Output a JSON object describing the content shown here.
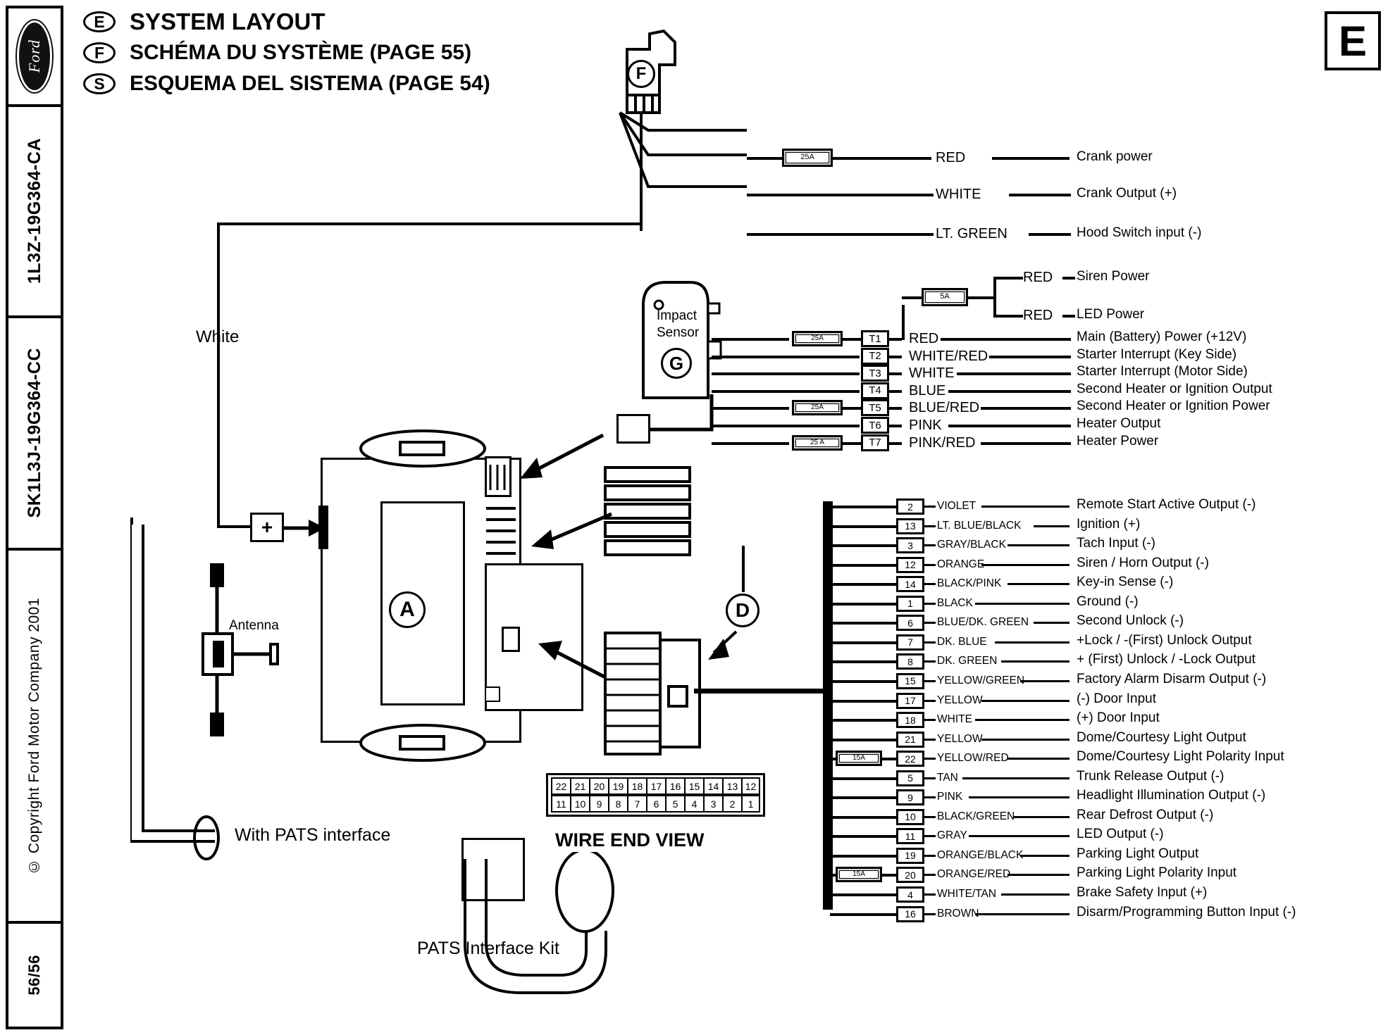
{
  "header": {
    "rows": [
      {
        "badge": "E",
        "title": "SYSTEM  LAYOUT"
      },
      {
        "badge": "F",
        "title": "SCHÉMA DU SYSTÈME (PAGE 55)"
      },
      {
        "badge": "S",
        "title": "ESQUEMA DEL SISTEMA (PAGE 54)"
      }
    ],
    "corner_badge": "E",
    "logo_text": "Ford"
  },
  "spine": {
    "part_number_1": "1L3Z-19G364-CA",
    "part_number_2": "SK1L3J-19G364-CC",
    "copyright": "© Copyright Ford Motor Company 2001",
    "page": "56/56"
  },
  "callouts": {
    "f": "F",
    "g": "G",
    "a": "A",
    "d": "D",
    "impact_sensor": "Impact\nSensor",
    "impact_sensor_line1": "Impact",
    "impact_sensor_line2": "Sensor",
    "white_label": "White",
    "antenna": "Antenna",
    "with_pats": "With PATS interface",
    "pats_kit": "PATS Interface Kit",
    "wire_end_view": "WIRE END VIEW"
  },
  "top_wires": [
    {
      "fuse": "25A",
      "color": "RED",
      "desc": "Crank power"
    },
    {
      "fuse": "",
      "color": "WHITE",
      "desc": "Crank Output (+)"
    },
    {
      "fuse": "",
      "color": "LT. GREEN",
      "desc": "Hood Switch input (-)"
    }
  ],
  "siren_branch": {
    "fuse": "5A",
    "wires": [
      {
        "color": "RED",
        "desc": "Siren Power"
      },
      {
        "color": "RED",
        "desc": "LED Power"
      }
    ]
  },
  "t_block": [
    {
      "fuse": "25A",
      "pin": "T1",
      "color": "RED",
      "desc": "Main (Battery) Power (+12V)"
    },
    {
      "fuse": "",
      "pin": "T2",
      "color": "WHITE/RED",
      "desc": "Starter Interrupt (Key Side)"
    },
    {
      "fuse": "",
      "pin": "T3",
      "color": "WHITE",
      "desc": "Starter Interrupt (Motor Side)"
    },
    {
      "fuse": "",
      "pin": "T4",
      "color": "BLUE",
      "desc": "Second Heater or Ignition Output"
    },
    {
      "fuse": "25A",
      "pin": "T5",
      "color": "BLUE/RED",
      "desc": "Second Heater or Ignition Power"
    },
    {
      "fuse": "",
      "pin": "T6",
      "color": "PINK",
      "desc": "Heater Output"
    },
    {
      "fuse": "25 A",
      "pin": "T7",
      "color": "PINK/RED",
      "desc": "Heater Power"
    }
  ],
  "main_harness": [
    {
      "fuse": "",
      "pin": "2",
      "color": "VIOLET",
      "desc": "Remote Start Active Output (-)"
    },
    {
      "fuse": "",
      "pin": "13",
      "color": "LT. BLUE/BLACK",
      "desc": "Ignition (+)"
    },
    {
      "fuse": "",
      "pin": "3",
      "color": "GRAY/BLACK",
      "desc": "Tach Input (-)"
    },
    {
      "fuse": "",
      "pin": "12",
      "color": "ORANGE",
      "desc": "Siren / Horn Output (-)"
    },
    {
      "fuse": "",
      "pin": "14",
      "color": "BLACK/PINK",
      "desc": "Key-in Sense (-)"
    },
    {
      "fuse": "",
      "pin": "1",
      "color": "BLACK",
      "desc": "Ground (-)"
    },
    {
      "fuse": "",
      "pin": "6",
      "color": "BLUE/DK. GREEN",
      "desc": "Second Unlock (-)"
    },
    {
      "fuse": "",
      "pin": "7",
      "color": "DK. BLUE",
      "desc": "+Lock / -(First) Unlock Output"
    },
    {
      "fuse": "",
      "pin": "8",
      "color": "DK. GREEN",
      "desc": "+ (First) Unlock / -Lock Output"
    },
    {
      "fuse": "",
      "pin": "15",
      "color": "YELLOW/GREEN",
      "desc": "Factory Alarm Disarm Output (-)"
    },
    {
      "fuse": "",
      "pin": "17",
      "color": "YELLOW",
      "desc": "(-) Door Input"
    },
    {
      "fuse": "",
      "pin": "18",
      "color": "WHITE",
      "desc": "(+) Door Input"
    },
    {
      "fuse": "",
      "pin": "21",
      "color": "YELLOW",
      "desc": "Dome/Courtesy Light Output"
    },
    {
      "fuse": "15A",
      "pin": "22",
      "color": "YELLOW/RED",
      "desc": "Dome/Courtesy Light Polarity Input"
    },
    {
      "fuse": "",
      "pin": "5",
      "color": "TAN",
      "desc": "Trunk Release Output (-)"
    },
    {
      "fuse": "",
      "pin": "9",
      "color": "PINK",
      "desc": "Headlight Illumination Output (-)"
    },
    {
      "fuse": "",
      "pin": "10",
      "color": "BLACK/GREEN",
      "desc": "Rear Defrost Output (-)"
    },
    {
      "fuse": "",
      "pin": "11",
      "color": "GRAY",
      "desc": "LED Output (-)"
    },
    {
      "fuse": "",
      "pin": "19",
      "color": "ORANGE/BLACK",
      "desc": "Parking Light Output"
    },
    {
      "fuse": "15A",
      "pin": "20",
      "color": "ORANGE/RED",
      "desc": "Parking Light Polarity Input"
    },
    {
      "fuse": "",
      "pin": "4",
      "color": "WHITE/TAN",
      "desc": "Brake Safety Input (+)"
    },
    {
      "fuse": "",
      "pin": "16",
      "color": "BROWN",
      "desc": "Disarm/Programming Button Input (-)"
    }
  ],
  "wire_end_view": {
    "top_row": [
      "22",
      "21",
      "20",
      "19",
      "18",
      "17",
      "16",
      "15",
      "14",
      "13",
      "12"
    ],
    "bottom_row": [
      "11",
      "10",
      "9",
      "8",
      "7",
      "6",
      "5",
      "4",
      "3",
      "2",
      "1"
    ]
  }
}
